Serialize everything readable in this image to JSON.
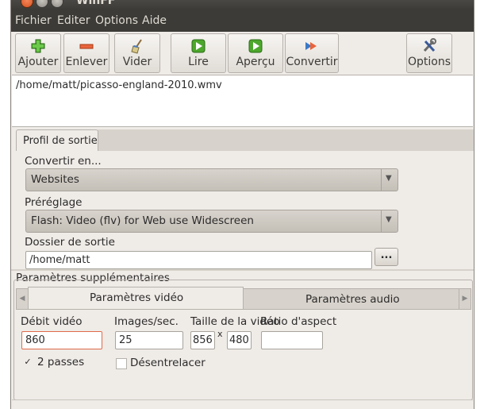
{
  "window": {
    "title": "WinFF"
  },
  "menu": {
    "items": [
      "Fichier",
      "Editer",
      "Options",
      "Aide"
    ]
  },
  "toolbar": {
    "buttons": [
      {
        "label": "Ajouter",
        "icon": "add-icon"
      },
      {
        "label": "Enlever",
        "icon": "remove-icon"
      },
      {
        "label": "Vider",
        "icon": "broom-icon"
      },
      {
        "label": "Lire",
        "icon": "play-icon"
      },
      {
        "label": "Aperçu",
        "icon": "preview-icon"
      },
      {
        "label": "Convertir",
        "icon": "convert-icon"
      },
      {
        "label": "Options",
        "icon": "tools-icon"
      }
    ]
  },
  "file_list": {
    "items": [
      "/home/matt/picasso-england-2010.wmv"
    ]
  },
  "output_profile": {
    "tab_label": "Profil de sortie",
    "convert_label": "Convertir en...",
    "convert_value": "Websites",
    "preset_label": "Préréglage",
    "preset_value": "Flash: Video (flv) for Web use Widescreen",
    "folder_label": "Dossier de sortie",
    "folder_value": "/home/matt",
    "browse_label": "..."
  },
  "extra": {
    "title": "Paramètres supplémentaires",
    "tab_video": "Paramètres vidéo",
    "tab_audio": "Paramètres audio",
    "bitrate_label": "Débit vidéo",
    "bitrate_value": "860",
    "fps_label": "Images/sec.",
    "fps_value": "25",
    "size_label": "Taille de la vidéo",
    "width_value": "856",
    "x_sep": "x",
    "height_value": "480",
    "aspect_label": "Ratio d'aspect",
    "aspect_value": "",
    "twopass_label": "2 passes",
    "twopass_checked": true,
    "deinterlace_label": "Désentrelacer",
    "deinterlace_checked": false
  },
  "colors": {
    "titlebar": "#3c3b37",
    "window_bg": "#efebe7",
    "accent_orange": "#e8643c",
    "focus_border": "#e06a4a"
  }
}
